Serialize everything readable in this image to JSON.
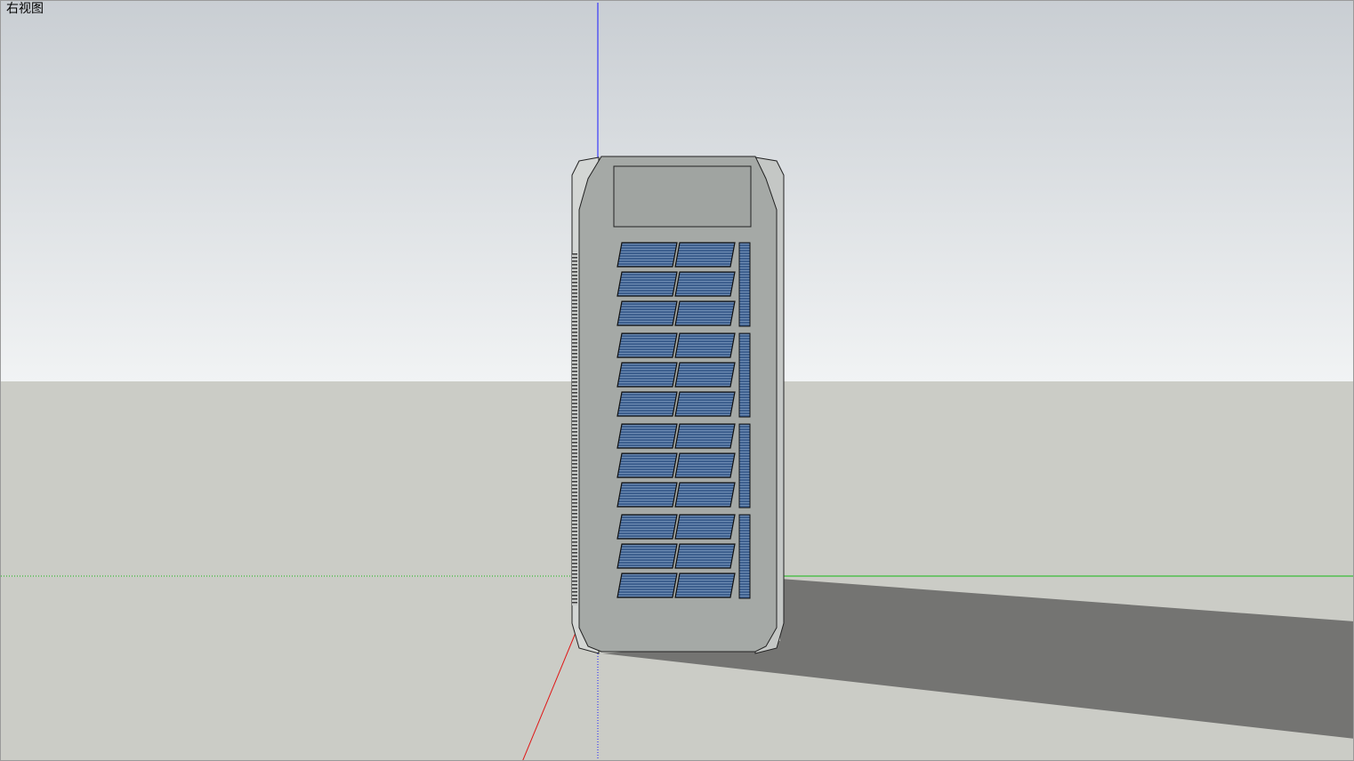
{
  "viewport": {
    "view_name": "右视图"
  },
  "scene": {
    "sky_top_color": "#c9ced3",
    "sky_bottom_color": "#f1f3f4",
    "ground_color": "#cbccc6",
    "shadow_color": "#747472",
    "facade_color": "#a5a9a6",
    "side_color": "#d3d6d4",
    "panel_color": "#3d5f8e",
    "axis_blue": "#1a1aff",
    "axis_red": "#e01515",
    "axis_green": "#14b814",
    "panel_rows": 12
  }
}
